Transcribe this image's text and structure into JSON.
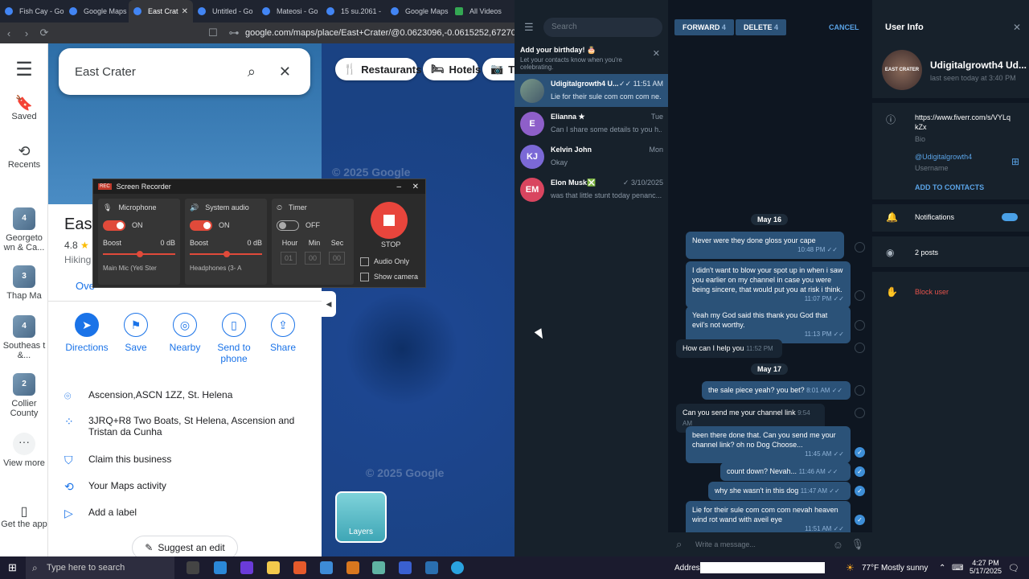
{
  "browser": {
    "tabs": [
      {
        "label": "Fish Cay - Go"
      },
      {
        "label": "Google Maps"
      },
      {
        "label": "East Crat"
      },
      {
        "label": "Untitled - Go"
      },
      {
        "label": "Mateosi - Go"
      },
      {
        "label": "15 su.2061 -"
      },
      {
        "label": "Google Maps"
      },
      {
        "label": "All Videos"
      }
    ],
    "url": "google.com/maps/place/East+Crater/@0.0623096,-0.0615252,67270m/data=!3m"
  },
  "maps": {
    "rail": [
      {
        "label": "Saved"
      },
      {
        "label": "Recents"
      },
      {
        "label": "Georgeto wn & Ca...",
        "badge": "4"
      },
      {
        "label": "Thap Ma",
        "badge": "3"
      },
      {
        "label": "Southeas t &...",
        "badge": "4"
      },
      {
        "label": "Collier County",
        "badge": "2"
      },
      {
        "label": "View more"
      },
      {
        "label": "Get the app"
      }
    ],
    "search_value": "East Crater",
    "chips": [
      "Restaurants",
      "Hotels",
      "Th"
    ],
    "place_title": "East",
    "rating": "4.8",
    "category": "Hiking",
    "tab_partial": "Ove",
    "actions": [
      "Directions",
      "Save",
      "Nearby",
      "Send to phone",
      "Share"
    ],
    "info": [
      {
        "text": "Ascension,ASCN 1ZZ, St. Helena"
      },
      {
        "text": "3JRQ+R8 Two Boats, St Helena, Ascension and Tristan da Cunha"
      },
      {
        "text": "Claim this business"
      },
      {
        "text": "Your Maps activity"
      },
      {
        "text": "Add a label"
      }
    ],
    "suggest": "Suggest an edit",
    "layers": "Layers",
    "watermark_top": "© 2025 Google",
    "watermark_bottom": "© 2025 Google"
  },
  "recorder": {
    "title": "Screen Recorder",
    "mic": {
      "label": "Microphone",
      "state": "ON",
      "boost": "Boost",
      "db": "0 dB",
      "device": "Main Mic (Yeti Ster"
    },
    "sys": {
      "label": "System audio",
      "state": "ON",
      "boost": "Boost",
      "db": "0 dB",
      "device": "Headphones (3- A"
    },
    "timer": {
      "label": "Timer",
      "state": "OFF",
      "hour": "Hour",
      "min": "Min",
      "sec": "Sec",
      "h": "01",
      "m": "00",
      "s": "00"
    },
    "stop": "STOP",
    "audio_only": "Audio Only",
    "show_camera": "Show camera"
  },
  "telegram": {
    "search_placeholder": "Search",
    "birthday_title": "Add your birthday! 🎂",
    "birthday_text": "Let your contacts know when you're celebrating.",
    "chats": [
      {
        "initials": "",
        "name": "Udigitalgrowth4 U...",
        "time": "11:51 AM",
        "preview": "Lie for their sule com com com ne...",
        "color": "#5a7a9a"
      },
      {
        "initials": "E",
        "name": "Elianna ★",
        "time": "Tue",
        "preview": "Can I share some details to you h...",
        "color": "#8e5fc9"
      },
      {
        "initials": "KJ",
        "name": "Kelvin John",
        "time": "Mon",
        "preview": "Okay",
        "color": "#7b69d6"
      },
      {
        "initials": "EM",
        "name": "Elon Musk❎",
        "time": "3/10/2025",
        "preview": "was that little stunt today penanc...",
        "color": "#d9455f"
      }
    ],
    "toolbar": {
      "forward": "FORWARD",
      "forward_count": "4",
      "delete": "DELETE",
      "delete_count": "4",
      "cancel": "CANCEL"
    },
    "dates": [
      "May 16",
      "May 17"
    ],
    "messages": [
      {
        "text": "Never were they done gloss your cape",
        "time": "10:48 PM"
      },
      {
        "text": "I didn't want to blow your spot up in when i saw you earlier on my channel in case you were being sincere, that would put you at risk i think.",
        "time": "11:07 PM"
      },
      {
        "text": "Yeah my God said this thank you God that evil's not worthy.",
        "time": "11:13 PM"
      },
      {
        "text": "How can I help you",
        "time": "11:52 PM"
      },
      {
        "text": "the sale piece yeah? you bet?",
        "time": "8:01 AM"
      },
      {
        "text": "Can you send me your channel link",
        "time": "9:54 AM"
      },
      {
        "text": "been there done that. Can you send me your channel link? oh no Dog Choose...",
        "time": "11:45 AM"
      },
      {
        "text": "count down? Nevah...",
        "time": "11:46 AM"
      },
      {
        "text": "why she wasn't in this dog",
        "time": "11:47 AM"
      },
      {
        "text": "Lie for their sule com com com nevah heaven wind rot wand with aveil eye",
        "time": "11:51 AM"
      }
    ],
    "compose_placeholder": "Write a message...",
    "user_info": {
      "title": "User Info",
      "name": "Udigitalgrowth4 Ud...",
      "last_seen": "last seen today at 3:40 PM",
      "bio": "https://www.fiverr.com/s/VYLqkZx",
      "bio_label": "Bio",
      "username": "@Udigitalgrowth4",
      "username_label": "Username",
      "add_contacts": "ADD TO CONTACTS",
      "notifications": "Notifications",
      "posts": "2 posts",
      "block": "Block user",
      "avatar_text": "EAST CRATER"
    }
  },
  "taskbar": {
    "search": "Type here to search",
    "address_label": "Address",
    "weather": "77°F  Mostly sunny",
    "time": "4:27 PM",
    "date": "5/17/2025"
  },
  "colors": {
    "accent": "#2b5278",
    "maps_blue": "#1a73e8",
    "record_red": "#e8453c"
  }
}
